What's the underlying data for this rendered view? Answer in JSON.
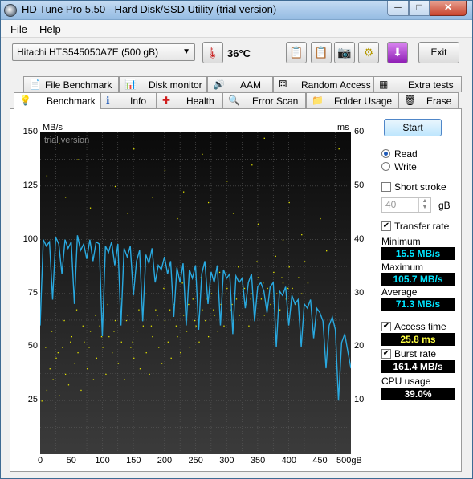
{
  "window": {
    "title": "HD Tune Pro 5.50 - Hard Disk/SSD Utility (trial version)",
    "min": "─",
    "max": "□",
    "close": "✕"
  },
  "menu": {
    "file": "File",
    "help": "Help"
  },
  "toolbar": {
    "drive": "Hitachi HTS545050A7E (500 gB)",
    "temperature": "36°C",
    "exit": "Exit"
  },
  "tabs_top": [
    {
      "label": "File Benchmark",
      "icon": "📄"
    },
    {
      "label": "Disk monitor",
      "icon": "📊"
    },
    {
      "label": "AAM",
      "icon": "🔊"
    },
    {
      "label": "Random Access",
      "icon": "⚃"
    },
    {
      "label": "Extra tests",
      "icon": "▦"
    }
  ],
  "tabs_bottom": [
    {
      "label": "Benchmark",
      "icon": "💡"
    },
    {
      "label": "Info",
      "icon": "ℹ"
    },
    {
      "label": "Health",
      "icon": "✚"
    },
    {
      "label": "Error Scan",
      "icon": "🔍"
    },
    {
      "label": "Folder Usage",
      "icon": "📁"
    },
    {
      "label": "Erase",
      "icon": "🗑"
    }
  ],
  "side": {
    "start": "Start",
    "read": "Read",
    "write": "Write",
    "short_stroke": "Short stroke",
    "short_stroke_value": "40",
    "short_stroke_unit": "gB",
    "transfer_rate": "Transfer rate",
    "minimum_label": "Minimum",
    "minimum": "15.5 MB/s",
    "maximum_label": "Maximum",
    "maximum": "105.7 MB/s",
    "average_label": "Average",
    "average": "71.3 MB/s",
    "access_time": "Access time",
    "access_value": "25.8 ms",
    "burst_rate": "Burst rate",
    "burst_value": "161.4 MB/s",
    "cpu_label": "CPU usage",
    "cpu_value": "39.0%"
  },
  "chart_data": {
    "type": "line",
    "watermark": "trial version",
    "y_left_unit": "MB/s",
    "y_right_unit": "ms",
    "y_left_ticks": [
      "150",
      "125",
      "100",
      "75",
      "50",
      "25"
    ],
    "y_right_ticks": [
      "60",
      "50",
      "40",
      "30",
      "20",
      "10"
    ],
    "x_ticks": [
      "0",
      "50",
      "100",
      "150",
      "200",
      "250",
      "300",
      "350",
      "400",
      "450",
      "500gB"
    ],
    "xlim": [
      0,
      500
    ],
    "ylim_left": [
      0,
      150
    ],
    "ylim_right": [
      0,
      60
    ],
    "series": [
      {
        "name": "Transfer rate",
        "color": "#29a9e0",
        "x": [
          0,
          5,
          10,
          15,
          20,
          25,
          30,
          35,
          40,
          45,
          50,
          55,
          60,
          65,
          70,
          75,
          80,
          85,
          90,
          95,
          100,
          105,
          110,
          115,
          120,
          125,
          130,
          135,
          140,
          145,
          150,
          155,
          160,
          165,
          170,
          175,
          180,
          185,
          190,
          195,
          200,
          205,
          210,
          215,
          220,
          225,
          230,
          235,
          240,
          245,
          250,
          255,
          260,
          265,
          270,
          275,
          280,
          285,
          290,
          295,
          300,
          305,
          310,
          315,
          320,
          325,
          330,
          335,
          340,
          345,
          350,
          355,
          360,
          365,
          370,
          375,
          380,
          385,
          390,
          395,
          400,
          405,
          410,
          415,
          420,
          425,
          430,
          435,
          440,
          445,
          450,
          455,
          460,
          465,
          470,
          475,
          480,
          485,
          490,
          495,
          500
        ],
        "y": [
          60,
          100,
          97,
          99,
          72,
          101,
          98,
          84,
          100,
          96,
          99,
          70,
          102,
          95,
          98,
          91,
          100,
          90,
          99,
          98,
          55,
          97,
          94,
          99,
          88,
          98,
          60,
          96,
          92,
          97,
          74,
          90,
          95,
          62,
          93,
          89,
          96,
          80,
          88,
          86,
          92,
          84,
          90,
          64,
          87,
          80,
          89,
          60,
          86,
          82,
          88,
          58,
          84,
          90,
          70,
          85,
          80,
          88,
          60,
          86,
          82,
          84,
          56,
          83,
          80,
          82,
          68,
          80,
          84,
          62,
          78,
          80,
          76,
          66,
          78,
          80,
          50,
          76,
          74,
          78,
          60,
          74,
          70,
          72,
          50,
          70,
          68,
          72,
          54,
          68,
          66,
          62,
          40,
          60,
          64,
          58,
          25,
          52,
          56,
          48,
          40
        ]
      }
    ],
    "access_points": [
      [
        2,
        10
      ],
      [
        10,
        12
      ],
      [
        15,
        16
      ],
      [
        20,
        14
      ],
      [
        25,
        18
      ],
      [
        30,
        11
      ],
      [
        35,
        20
      ],
      [
        40,
        15
      ],
      [
        45,
        13
      ],
      [
        50,
        22
      ],
      [
        55,
        17
      ],
      [
        60,
        19
      ],
      [
        65,
        12
      ],
      [
        70,
        21
      ],
      [
        75,
        16
      ],
      [
        80,
        23
      ],
      [
        85,
        14
      ],
      [
        90,
        18
      ],
      [
        95,
        24
      ],
      [
        100,
        20
      ],
      [
        105,
        15
      ],
      [
        110,
        22
      ],
      [
        115,
        19
      ],
      [
        120,
        25
      ],
      [
        125,
        17
      ],
      [
        130,
        21
      ],
      [
        135,
        14
      ],
      [
        140,
        26
      ],
      [
        145,
        20
      ],
      [
        150,
        18
      ],
      [
        155,
        23
      ],
      [
        160,
        16
      ],
      [
        165,
        24
      ],
      [
        170,
        19
      ],
      [
        175,
        15
      ],
      [
        180,
        22
      ],
      [
        185,
        27
      ],
      [
        190,
        20
      ],
      [
        195,
        17
      ],
      [
        200,
        25
      ],
      [
        205,
        21
      ],
      [
        210,
        18
      ],
      [
        215,
        28
      ],
      [
        220,
        22
      ],
      [
        225,
        19
      ],
      [
        230,
        26
      ],
      [
        235,
        23
      ],
      [
        240,
        20
      ],
      [
        245,
        29
      ],
      [
        250,
        24
      ],
      [
        255,
        21
      ],
      [
        260,
        27
      ],
      [
        265,
        25
      ],
      [
        270,
        22
      ],
      [
        275,
        30
      ],
      [
        280,
        26
      ],
      [
        285,
        23
      ],
      [
        290,
        28
      ],
      [
        295,
        24
      ],
      [
        300,
        31
      ],
      [
        305,
        27
      ],
      [
        310,
        25
      ],
      [
        315,
        29
      ],
      [
        320,
        26
      ],
      [
        325,
        32
      ],
      [
        330,
        28
      ],
      [
        335,
        24
      ],
      [
        340,
        30
      ],
      [
        345,
        27
      ],
      [
        350,
        33
      ],
      [
        355,
        29
      ],
      [
        360,
        26
      ],
      [
        365,
        31
      ],
      [
        370,
        28
      ],
      [
        375,
        34
      ],
      [
        380,
        30
      ],
      [
        385,
        27
      ],
      [
        390,
        32
      ],
      [
        395,
        29
      ],
      [
        400,
        35
      ],
      [
        405,
        31
      ],
      [
        410,
        28
      ],
      [
        415,
        33
      ],
      [
        420,
        30
      ],
      [
        425,
        36
      ],
      [
        430,
        32
      ],
      [
        10,
        52
      ],
      [
        30,
        58
      ],
      [
        60,
        55
      ],
      [
        90,
        61
      ],
      [
        120,
        50
      ],
      [
        150,
        57
      ],
      [
        200,
        53
      ],
      [
        230,
        49
      ],
      [
        260,
        56
      ],
      [
        300,
        51
      ],
      [
        340,
        54
      ],
      [
        360,
        59
      ],
      [
        400,
        47
      ],
      [
        450,
        44
      ],
      [
        480,
        57
      ],
      [
        40,
        48
      ],
      [
        80,
        46
      ],
      [
        140,
        45
      ],
      [
        180,
        48
      ],
      [
        220,
        44
      ],
      [
        270,
        47
      ],
      [
        310,
        45
      ],
      [
        350,
        43
      ],
      [
        390,
        40
      ],
      [
        420,
        41
      ],
      [
        460,
        38
      ],
      [
        8,
        20
      ],
      [
        18,
        23
      ],
      [
        28,
        19
      ],
      [
        38,
        25
      ],
      [
        48,
        21
      ],
      [
        58,
        27
      ],
      [
        68,
        24
      ],
      [
        78,
        20
      ],
      [
        88,
        26
      ],
      [
        98,
        22
      ],
      [
        108,
        28
      ],
      [
        118,
        23
      ],
      [
        128,
        29
      ],
      [
        138,
        25
      ],
      [
        148,
        21
      ],
      [
        158,
        27
      ],
      [
        168,
        30
      ],
      [
        178,
        24
      ],
      [
        188,
        26
      ],
      [
        198,
        31
      ],
      [
        208,
        27
      ],
      [
        218,
        24
      ],
      [
        228,
        32
      ],
      [
        238,
        28
      ],
      [
        248,
        25
      ],
      [
        258,
        33
      ],
      [
        268,
        29
      ],
      [
        278,
        27
      ],
      [
        288,
        34
      ],
      [
        298,
        30
      ],
      [
        308,
        28
      ],
      [
        318,
        35
      ],
      [
        328,
        31
      ],
      [
        338,
        29
      ],
      [
        348,
        36
      ],
      [
        358,
        32
      ],
      [
        368,
        30
      ],
      [
        378,
        37
      ],
      [
        388,
        33
      ],
      [
        398,
        31
      ]
    ]
  }
}
